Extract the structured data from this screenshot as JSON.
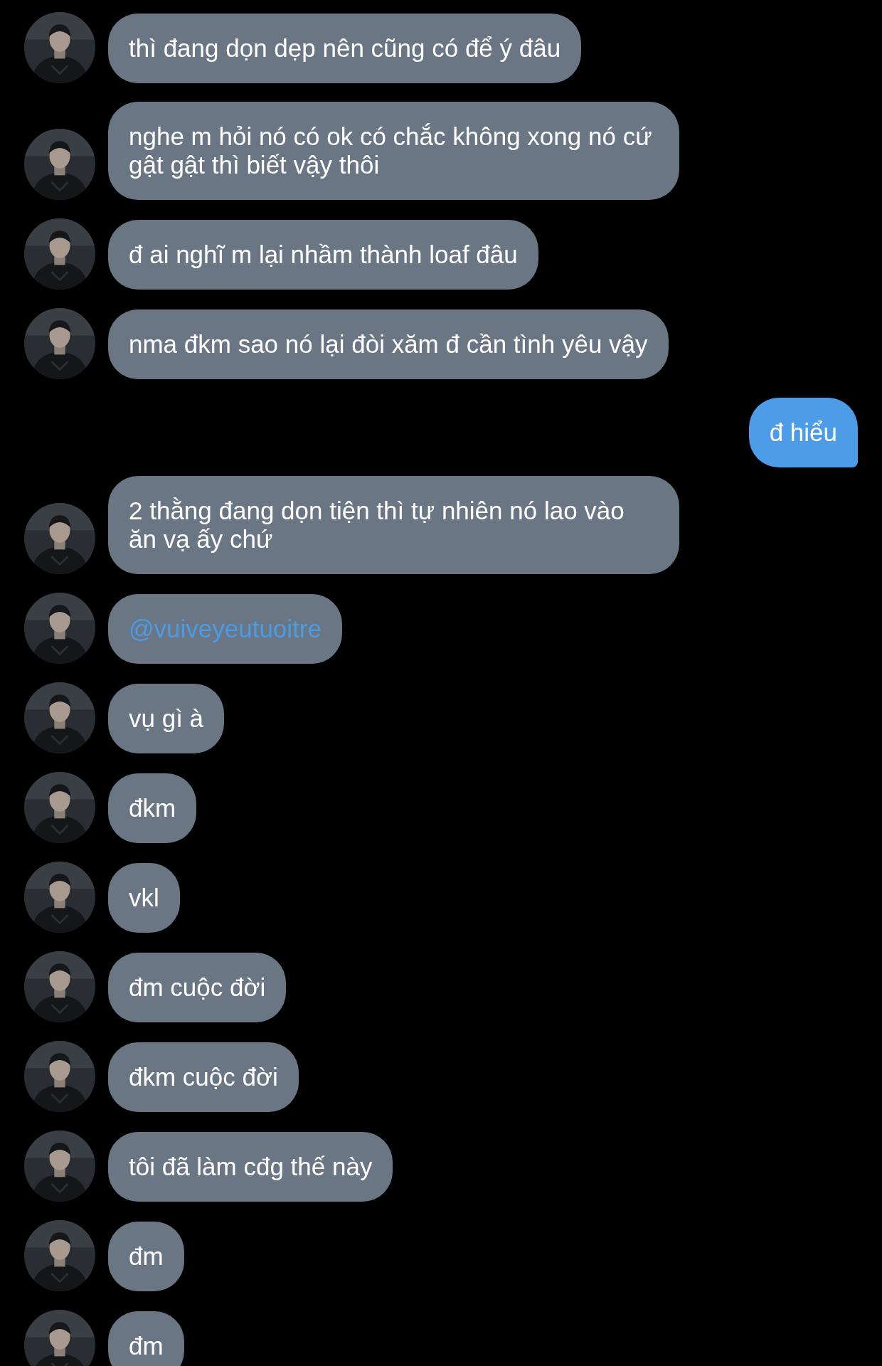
{
  "messages": [
    {
      "outgoing": false,
      "kind": "text",
      "text": "thì đang dọn dẹp nên cũng có để ý đâu"
    },
    {
      "outgoing": false,
      "kind": "text",
      "text": "nghe m hỏi nó có ok có chắc không xong nó cứ gật gật thì biết vậy thôi"
    },
    {
      "outgoing": false,
      "kind": "text",
      "text": "đ ai nghĩ m lại nhầm thành loaf đâu"
    },
    {
      "outgoing": false,
      "kind": "text",
      "text": "nma đkm sao nó lại đòi xăm đ cần tình yêu vậy"
    },
    {
      "outgoing": true,
      "kind": "text",
      "text": "đ hiểu"
    },
    {
      "outgoing": false,
      "kind": "text",
      "text": "2 thằng đang dọn tiện thì tự nhiên nó lao vào ăn vạ ấy chứ"
    },
    {
      "outgoing": false,
      "kind": "mention",
      "text": "@vuiveyeutuoitre"
    },
    {
      "outgoing": false,
      "kind": "text",
      "text": "vụ gì à"
    },
    {
      "outgoing": false,
      "kind": "text",
      "text": "đkm"
    },
    {
      "outgoing": false,
      "kind": "text",
      "text": "vkl"
    },
    {
      "outgoing": false,
      "kind": "text",
      "text": "đm cuộc đời"
    },
    {
      "outgoing": false,
      "kind": "text",
      "text": "đkm cuộc đời"
    },
    {
      "outgoing": false,
      "kind": "text",
      "text": "tôi đã làm cđg thế này"
    },
    {
      "outgoing": false,
      "kind": "text",
      "text": "đm"
    },
    {
      "outgoing": false,
      "kind": "text",
      "text": "đm"
    }
  ]
}
